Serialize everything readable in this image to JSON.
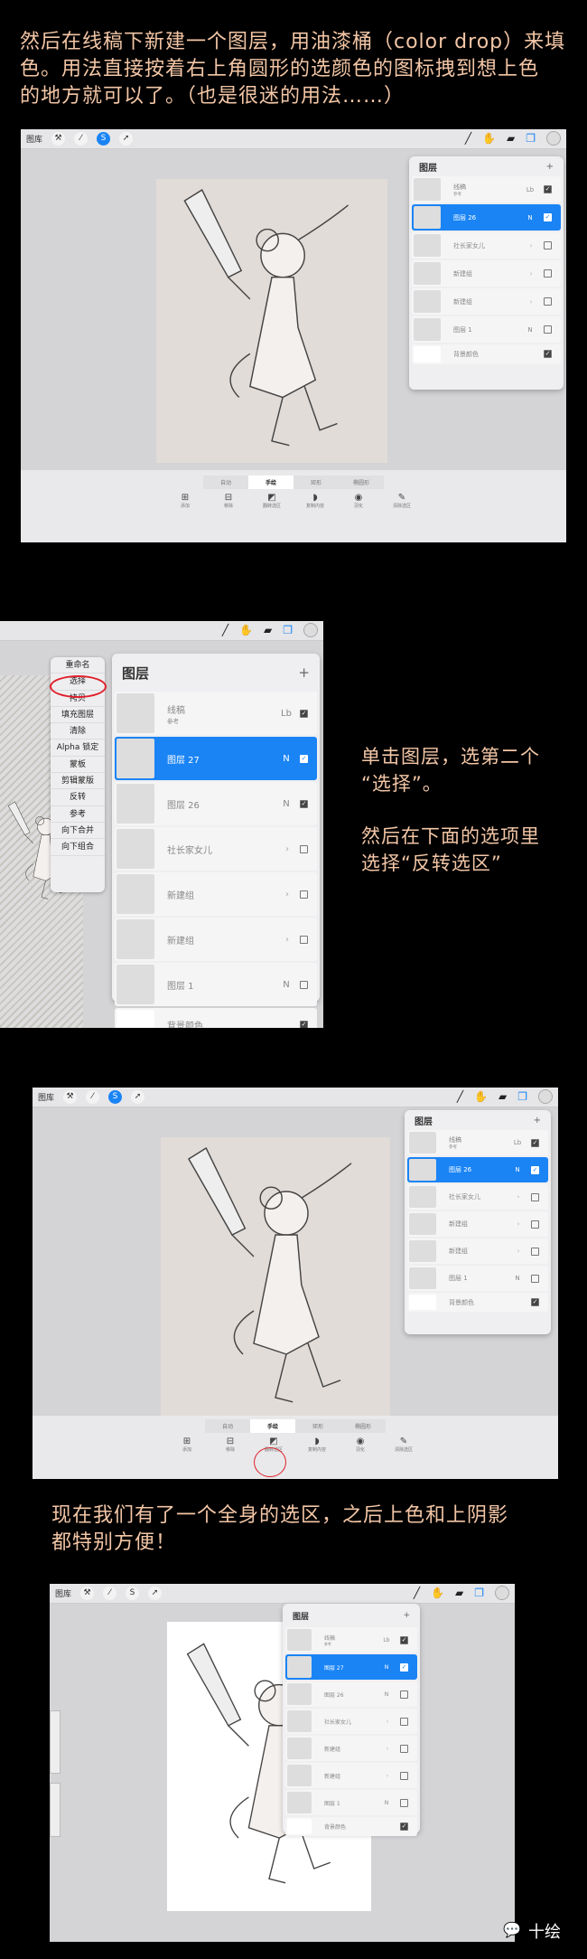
{
  "captions": {
    "intro": [
      "然后在线稿下新建一个图层，用油漆桶（color drop）来填",
      "色。用法直接按着右上角圆形的选颜色的图标拽到想上色",
      "的地方就可以了。（也是很迷的用法……）"
    ],
    "step": [
      "单击图层，选第二个",
      "“选择”。",
      "然后在下面的选项里",
      "选择“反转选区”"
    ],
    "result": [
      "现在我们有了一个全身的选区，之后上色和上阴影",
      "都特别方便！"
    ]
  },
  "app": {
    "gallery": "图库",
    "left_icons": [
      "wrench-icon",
      "magic-wand-icon",
      "selection-icon",
      "transform-arrow-icon"
    ],
    "left_glyphs": [
      "⚒",
      "⁄",
      "S",
      "➚"
    ],
    "right_icons": [
      "brush-icon",
      "smudge-icon",
      "eraser-icon",
      "layers-icon"
    ],
    "right_glyphs": [
      "╱",
      "✋",
      "▰",
      "❐"
    ],
    "accent": "#1a84f5",
    "layers_title": "图层",
    "add_glyph": "+",
    "selection_modes": [
      "自动",
      "手绘",
      "矩形",
      "椭圆形"
    ],
    "selection_tools": [
      {
        "label": "添加",
        "icon": "plus-square-icon",
        "glyph": "⊞"
      },
      {
        "label": "移除",
        "icon": "minus-square-icon",
        "glyph": "⊟"
      },
      {
        "label": "翻转选区",
        "icon": "invert-selection-icon",
        "glyph": "◩"
      },
      {
        "label": "复制内容",
        "icon": "copy-paste-icon",
        "glyph": "◗"
      },
      {
        "label": "羽化",
        "icon": "feather-icon",
        "glyph": "◉"
      },
      {
        "label": "清除选区",
        "icon": "clear-selection-icon",
        "glyph": "✎"
      }
    ]
  },
  "screens": [
    {
      "layers": [
        {
          "name": "线稿",
          "sub": "参考",
          "mode": "Lb",
          "checked": true
        },
        {
          "name": "图层 26",
          "mode": "N",
          "checked": true,
          "selected": true
        },
        {
          "name": "社长家女儿",
          "group": true,
          "checked": false
        },
        {
          "name": "新建组",
          "group": true,
          "checked": false
        },
        {
          "name": "新建组",
          "group": true,
          "checked": false
        },
        {
          "name": "图层 1",
          "mode": "N",
          "checked": false
        },
        {
          "name": "背景颜色",
          "checked": true,
          "bg": true
        }
      ],
      "mode_selected": 1
    },
    {
      "layers": [
        {
          "name": "线稿",
          "sub": "参考",
          "mode": "Lb",
          "checked": true
        },
        {
          "name": "图层 27",
          "mode": "N",
          "checked": true,
          "selected": true
        },
        {
          "name": "图层 26",
          "mode": "N",
          "checked": true
        },
        {
          "name": "社长家女儿",
          "group": true,
          "checked": false
        },
        {
          "name": "新建组",
          "group": true,
          "checked": false
        },
        {
          "name": "新建组",
          "group": true,
          "checked": false
        },
        {
          "name": "图层 1",
          "mode": "N",
          "checked": false
        },
        {
          "name": "背景颜色",
          "checked": true,
          "bg": true
        }
      ],
      "context_menu": [
        "重命名",
        "选择",
        "拷贝",
        "填充图层",
        "清除",
        "Alpha 锁定",
        "蒙板",
        "剪辑蒙版",
        "反转",
        "参考",
        "向下合并",
        "向下组合"
      ],
      "highlighted_menu_item": "选择"
    },
    {
      "layers": [
        {
          "name": "线稿",
          "sub": "参考",
          "mode": "Lb",
          "checked": true
        },
        {
          "name": "图层 26",
          "mode": "N",
          "checked": true,
          "selected": true
        },
        {
          "name": "社长家女儿",
          "group": true,
          "checked": false
        },
        {
          "name": "新建组",
          "group": true,
          "checked": false
        },
        {
          "name": "新建组",
          "group": true,
          "checked": false
        },
        {
          "name": "图层 1",
          "mode": "N",
          "checked": false
        },
        {
          "name": "背景颜色",
          "checked": true,
          "bg": true
        }
      ],
      "mode_selected": 1,
      "highlighted_tool": "翻转选区"
    },
    {
      "layers": [
        {
          "name": "线稿",
          "sub": "参考",
          "mode": "Lb",
          "checked": true
        },
        {
          "name": "图层 27",
          "mode": "N",
          "checked": true,
          "selected": true
        },
        {
          "name": "图层 26",
          "mode": "N",
          "checked": false
        },
        {
          "name": "社长家女儿",
          "group": true,
          "checked": false
        },
        {
          "name": "新建组",
          "group": true,
          "checked": false
        },
        {
          "name": "新建组",
          "group": true,
          "checked": false
        },
        {
          "name": "图层 1",
          "mode": "N",
          "checked": false
        },
        {
          "name": "背景颜色",
          "checked": true,
          "bg": true
        }
      ]
    }
  ],
  "group_chevron": "›",
  "check_glyph": "✓",
  "watermark": "十绘",
  "watermark_icon": "wechat-icon"
}
